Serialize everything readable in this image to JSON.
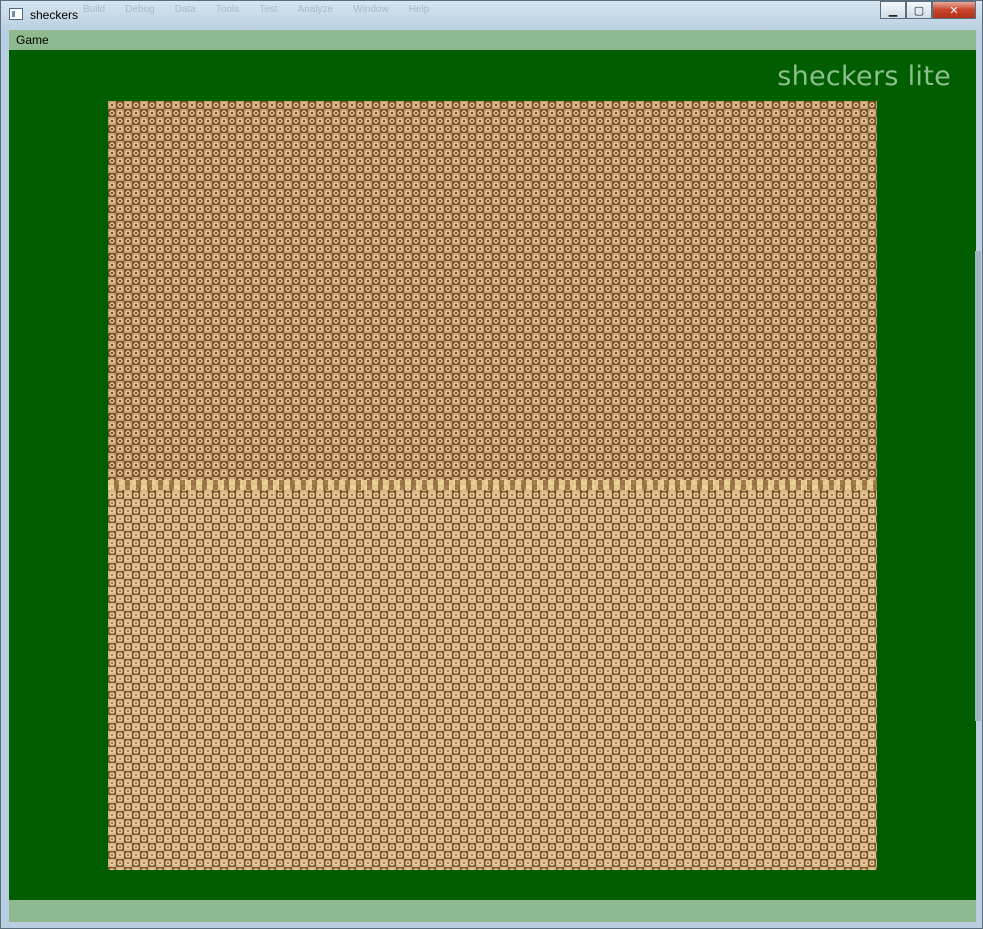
{
  "window": {
    "title": "sheckers",
    "background_menu_ghost": [
      "Build",
      "Debug",
      "Data",
      "Tools",
      "Test",
      "Analyze",
      "Window",
      "Help"
    ]
  },
  "caption_buttons": {
    "minimize": "▁",
    "maximize": "▢",
    "close": "✕"
  },
  "menu": {
    "items": [
      {
        "label": "Game"
      }
    ]
  },
  "brand": {
    "text": "sheckers lite"
  },
  "colors": {
    "client_background": "#005e00",
    "menubar": "#8fba8f",
    "brand_text": "#8dbe8d"
  },
  "board": {
    "description_icon": "checker-board"
  }
}
